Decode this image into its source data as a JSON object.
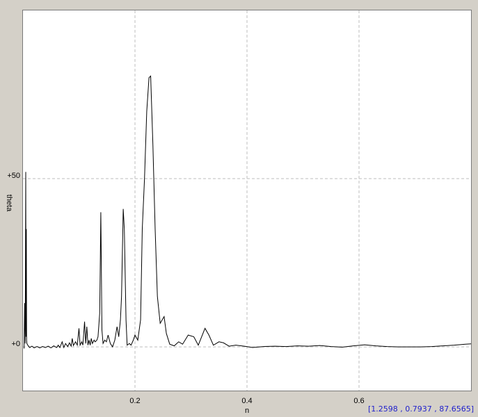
{
  "chart_data": {
    "type": "line",
    "title": "",
    "xlabel": "n",
    "ylabel": "theta",
    "xlim": [
      0.0,
      0.8
    ],
    "ylim": [
      -13,
      100
    ],
    "x_ticks": [
      {
        "value": 0.2,
        "label": "0.2"
      },
      {
        "value": 0.4,
        "label": "0.4"
      },
      {
        "value": 0.6,
        "label": "0.6"
      }
    ],
    "y_ticks": [
      {
        "value": 0,
        "label": "+0"
      },
      {
        "value": 50,
        "label": "+50"
      }
    ],
    "grid": true,
    "series": [
      {
        "values": [
          [
            0.002,
            -0.5
          ],
          [
            0.003,
            13
          ],
          [
            0.004,
            1
          ],
          [
            0.005,
            52
          ],
          [
            0.0055,
            3
          ],
          [
            0.006,
            35
          ],
          [
            0.0065,
            2
          ],
          [
            0.007,
            1
          ],
          [
            0.009,
            0.4
          ],
          [
            0.012,
            -0.2
          ],
          [
            0.016,
            0.2
          ],
          [
            0.02,
            -0.3
          ],
          [
            0.025,
            0.1
          ],
          [
            0.03,
            -0.3
          ],
          [
            0.035,
            0.1
          ],
          [
            0.04,
            -0.2
          ],
          [
            0.045,
            0.2
          ],
          [
            0.05,
            -0.3
          ],
          [
            0.055,
            0.3
          ],
          [
            0.06,
            -0.2
          ],
          [
            0.063,
            0.5
          ],
          [
            0.066,
            -0.2
          ],
          [
            0.07,
            1.5
          ],
          [
            0.073,
            -0.2
          ],
          [
            0.076,
            1
          ],
          [
            0.08,
            0.1
          ],
          [
            0.083,
            1.2
          ],
          [
            0.086,
            0.2
          ],
          [
            0.088,
            2.5
          ],
          [
            0.09,
            0.4
          ],
          [
            0.094,
            1.5
          ],
          [
            0.097,
            0.5
          ],
          [
            0.1,
            5.5
          ],
          [
            0.102,
            0.5
          ],
          [
            0.105,
            1.5
          ],
          [
            0.107,
            0.5
          ],
          [
            0.11,
            7.5
          ],
          [
            0.112,
            1
          ],
          [
            0.114,
            6
          ],
          [
            0.116,
            0.5
          ],
          [
            0.118,
            2
          ],
          [
            0.12,
            0.5
          ],
          [
            0.122,
            2.5
          ],
          [
            0.124,
            1
          ],
          [
            0.127,
            2
          ],
          [
            0.129,
            1.5
          ],
          [
            0.132,
            2
          ],
          [
            0.134,
            3
          ],
          [
            0.137,
            10
          ],
          [
            0.139,
            40
          ],
          [
            0.141,
            5
          ],
          [
            0.143,
            1
          ],
          [
            0.146,
            2
          ],
          [
            0.149,
            1.5
          ],
          [
            0.152,
            3.5
          ],
          [
            0.156,
            1
          ],
          [
            0.16,
            0
          ],
          [
            0.164,
            2
          ],
          [
            0.168,
            6
          ],
          [
            0.171,
            3
          ],
          [
            0.174,
            8
          ],
          [
            0.176,
            15
          ],
          [
            0.179,
            41
          ],
          [
            0.181,
            35
          ],
          [
            0.184,
            8
          ],
          [
            0.186,
            0.5
          ],
          [
            0.19,
            1
          ],
          [
            0.193,
            0.5
          ],
          [
            0.197,
            2
          ],
          [
            0.2,
            3.5
          ],
          [
            0.205,
            2
          ],
          [
            0.21,
            8
          ],
          [
            0.213,
            35
          ],
          [
            0.217,
            50
          ],
          [
            0.221,
            70
          ],
          [
            0.225,
            80
          ],
          [
            0.228,
            80.5
          ],
          [
            0.232,
            60
          ],
          [
            0.236,
            35
          ],
          [
            0.24,
            15
          ],
          [
            0.245,
            7
          ],
          [
            0.252,
            9
          ],
          [
            0.256,
            4
          ],
          [
            0.262,
            0.8
          ],
          [
            0.27,
            0.3
          ],
          [
            0.278,
            1.5
          ],
          [
            0.285,
            0.8
          ],
          [
            0.295,
            3.5
          ],
          [
            0.305,
            3
          ],
          [
            0.313,
            0.5
          ],
          [
            0.325,
            5.5
          ],
          [
            0.332,
            3.5
          ],
          [
            0.34,
            0.5
          ],
          [
            0.35,
            1.5
          ],
          [
            0.358,
            1.2
          ],
          [
            0.368,
            0.2
          ],
          [
            0.38,
            0.5
          ],
          [
            0.395,
            0.2
          ],
          [
            0.41,
            -0.2
          ],
          [
            0.43,
            0.1
          ],
          [
            0.45,
            0.2
          ],
          [
            0.47,
            0.1
          ],
          [
            0.49,
            0.3
          ],
          [
            0.51,
            0.2
          ],
          [
            0.53,
            0.4
          ],
          [
            0.55,
            0.1
          ],
          [
            0.57,
            -0.1
          ],
          [
            0.59,
            0.3
          ],
          [
            0.61,
            0.6
          ],
          [
            0.63,
            0.3
          ],
          [
            0.65,
            0.1
          ],
          [
            0.67,
            0.0
          ],
          [
            0.69,
            0.0
          ],
          [
            0.71,
            0.0
          ],
          [
            0.73,
            0.1
          ],
          [
            0.75,
            0.3
          ],
          [
            0.77,
            0.5
          ],
          [
            0.79,
            0.8
          ],
          [
            0.8,
            0.9
          ]
        ]
      }
    ]
  },
  "status": {
    "cursor_readout": "[1.2598 , 0.7937 , 87.6565]"
  }
}
